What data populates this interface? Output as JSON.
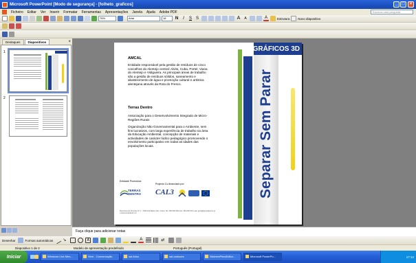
{
  "window": {
    "title": "Microsoft PowerPoint [Modo de segurança] - [folheto_graficos]"
  },
  "menu": {
    "items": [
      "Ficheiro",
      "Editar",
      "Ver",
      "Inserir",
      "Formatar",
      "Ferramentas",
      "Apresentações",
      "Janela",
      "Ajuda",
      "Adobe PDF"
    ],
    "help_placeholder": "Escreva uma pergunta"
  },
  "toolbar": {
    "zoom": "76%",
    "font": "Arial",
    "font_size": "18",
    "design_label": "Estrutura",
    "new_slide_label": "Novo diapositivo"
  },
  "panel": {
    "tabs": [
      "Destaques",
      "Diapositivos"
    ],
    "active_tab": "Diapositivos",
    "slide_numbers": [
      "1",
      "2"
    ]
  },
  "slide": {
    "corner_title": "GRÁFICOS 3D",
    "vertical_title": "Separar Sem Parar",
    "section1": {
      "heading": "AMCAL",
      "body": "Entidade responsável pela gestão de resíduos de cinco concelhos do Alentejo central: Alvito, Cuba, Portel, Viana do Alentejo e Vidigueira. As principais áreas de trabalho são a gestão de resíduos sólidos, saneamento e abastecimento de água e promoção cultural e artística alentejana através da Rota do Fresco."
    },
    "section2": {
      "heading": "Terras Dentro",
      "body1": "Associação para o Desenvolvimento Integrado de Micro-Regiões Rurais",
      "body2": "Organização Não Governamental para o Ambiente, sem fins lucrativos, com larga experiência de trabalho na área da Educação Ambiental, concepção de materiais e actividades de carácter lúdico pedagógico promovendo o envolvimento participativo em todas as idades das populações locais."
    },
    "footer": {
      "promoter_label": "Entidade Promotora:",
      "cofinanced_label": "Projecto Co-financiado por:",
      "logo_terras": "TERRAS DENTRO",
      "logo_cal": "CAL3",
      "address": "Rua Nova do Príncipe Nº 1 - 7940-123 Bairro Alto, Cuba | Tel: 284 000 000 Fax: 284 000 001 mail: geral@terrasdentro.pt | www.terrasdentro.pt"
    },
    "colors": {
      "green": "#7cb342",
      "navy": "#1e3f8f",
      "gold": "#f0d21a",
      "gray": "#8c8c8c"
    }
  },
  "notes": {
    "placeholder": "Faça clique para adicionar notas"
  },
  "drawbar": {
    "draw_label": "Desenhar",
    "autoshapes_label": "Formas automáticas"
  },
  "status": {
    "slide_position": "Diapositivo 1 de 2",
    "template": "Modelo de apresentação predefinido",
    "language": "Português (Portugal)"
  },
  "taskbar": {
    "start_label": "Iniciar",
    "tasks": [
      "Windows Live Mes...",
      "Sem - Conversação",
      "sai-fotos",
      "sai-cartazes",
      "SistemaPimaEditor...",
      "Microsoft PowerPo..."
    ],
    "active_task": 5,
    "clock": "17:12"
  }
}
